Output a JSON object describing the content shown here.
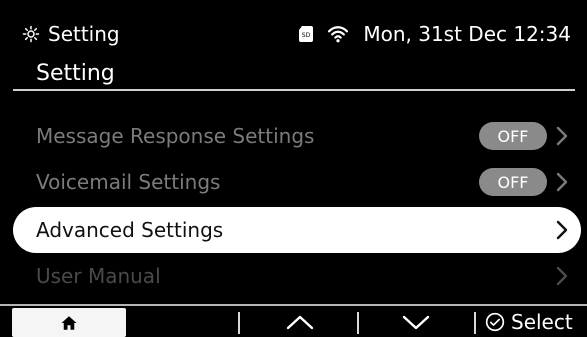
{
  "status_bar": {
    "app_title": "Setting",
    "datetime": "Mon, 31st Dec 12:34",
    "icons": [
      "gear-icon",
      "sd-card-icon",
      "wifi-icon"
    ]
  },
  "page": {
    "title": "Setting"
  },
  "menu": {
    "items": [
      {
        "label": "Message Response Settings",
        "toggle": "OFF"
      },
      {
        "label": "Voicemail Settings",
        "toggle": "OFF"
      },
      {
        "label": "Advanced Settings",
        "selected": true
      },
      {
        "label": "User Manual"
      }
    ]
  },
  "softkeys": {
    "home": "home-icon",
    "up": "chevron-up-icon",
    "down": "chevron-down-icon",
    "select_label": "Select"
  },
  "colors": {
    "background": "#000000",
    "selected_row": "#ffffff",
    "disabled_text": "#7b7b7b",
    "toggle_bg": "#8a8a8a"
  }
}
